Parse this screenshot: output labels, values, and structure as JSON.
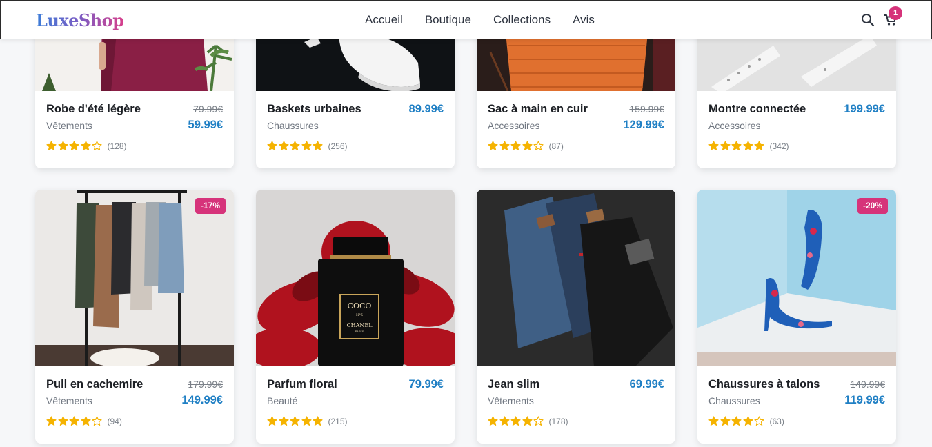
{
  "header": {
    "logo": "LuxeShop",
    "nav": [
      "Accueil",
      "Boutique",
      "Collections",
      "Avis"
    ],
    "cart_count": "1"
  },
  "colors": {
    "accent_price": "#1f7fc4",
    "badge": "#d6337a",
    "star": "#f5b301"
  },
  "products": [
    {
      "name": "Robe d'été légère",
      "category": "Vêtements",
      "old_price": "79.99€",
      "price": "59.99€",
      "rating": 4,
      "reviews": "(128)"
    },
    {
      "name": "Baskets urbaines",
      "category": "Chaussures",
      "old_price": "",
      "price": "89.99€",
      "rating": 5,
      "reviews": "(256)"
    },
    {
      "name": "Sac à main en cuir",
      "category": "Accessoires",
      "old_price": "159.99€",
      "price": "129.99€",
      "rating": 4,
      "reviews": "(87)"
    },
    {
      "name": "Montre connectée",
      "category": "Accessoires",
      "old_price": "",
      "price": "199.99€",
      "rating": 5,
      "reviews": "(342)"
    },
    {
      "name": "Pull en cachemire",
      "category": "Vêtements",
      "old_price": "179.99€",
      "price": "149.99€",
      "rating": 4,
      "reviews": "(94)",
      "badge": "-17%"
    },
    {
      "name": "Parfum floral",
      "category": "Beauté",
      "old_price": "",
      "price": "79.99€",
      "rating": 5,
      "reviews": "(215)",
      "perfume_label": [
        "COCO",
        "N°5",
        "CHANEL",
        "PARIS"
      ]
    },
    {
      "name": "Jean slim",
      "category": "Vêtements",
      "old_price": "",
      "price": "69.99€",
      "rating": 4,
      "reviews": "(178)"
    },
    {
      "name": "Chaussures à talons",
      "category": "Chaussures",
      "old_price": "149.99€",
      "price": "119.99€",
      "rating": 4,
      "reviews": "(63)",
      "badge": "-20%"
    }
  ]
}
